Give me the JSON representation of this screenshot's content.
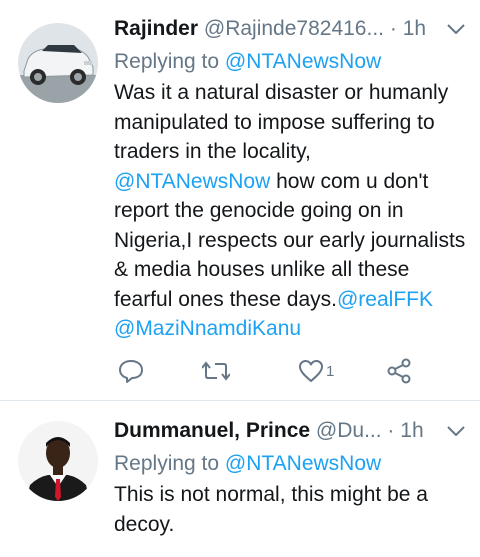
{
  "tweets": [
    {
      "author_name": "Rajinder",
      "author_handle": "@Rajinde782416...",
      "separator": "·",
      "time": "1h",
      "replying_label": "Replying to",
      "replying_to": "@NTANewsNow",
      "body_segments": [
        "Was it a natural disaster or humanly manipulated to impose suffering to traders in the locality, ",
        "@NTANewsNow",
        " how com u don't report the genocide going on in Nigeria,I respects our early journalists & media houses unlike all these fearful ones these days.",
        "@realFFK",
        " ",
        "@MaziNnamdiKanu"
      ],
      "like_count": "1"
    },
    {
      "author_name": "Dummanuel, Prince",
      "author_handle": "@Du...",
      "separator": "·",
      "time": "1h",
      "replying_label": "Replying to",
      "replying_to": "@NTANewsNow",
      "body": "This is not normal, this might be a decoy."
    }
  ],
  "icons": [
    "reply-icon",
    "retweet-icon",
    "like-icon",
    "share-icon",
    "chevron-down-icon"
  ],
  "colors": {
    "link": "#1da1f2",
    "secondary": "#657786",
    "text": "#14171a",
    "divider": "#e1e8ed"
  }
}
